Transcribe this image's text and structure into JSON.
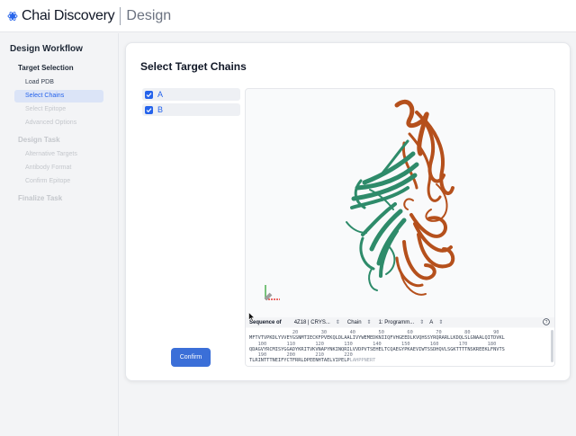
{
  "header": {
    "brand": "Chai Discovery",
    "section": "Design"
  },
  "sidebar": {
    "title": "Design Workflow",
    "groups": [
      {
        "label": "Target Selection",
        "items": [
          "Load PDB",
          "Select Chains",
          "Select Epitope",
          "Advanced Options"
        ]
      },
      {
        "label": "Design Task",
        "items": [
          "Alternative Targets",
          "Antibody Format",
          "Confirm Epitope"
        ]
      },
      {
        "label": "Finalize Task"
      }
    ]
  },
  "main": {
    "title": "Select Target Chains",
    "chains": [
      {
        "label": "A",
        "checked": true
      },
      {
        "label": "B",
        "checked": true
      }
    ],
    "confirm_label": "Confirm"
  },
  "viewer": {
    "seq_label": "Sequence of",
    "entry": "4Z18 | CRYS...",
    "mode": "Chain",
    "molecule": "1: Programm...",
    "chain": "A",
    "ruler1": "               20        30        40        50        60        70        80        90",
    "seq1": "MFTVTVPKDLYVVEYGSNMTIECKFPVEKQLDLAALIVYWEMEDKNIIQFVHGEEDLKVQHSSYRQRARLLKDQLSLGNAALQITDVKL",
    "ruler2": "   100       110       120       130       140       150       160       170       180",
    "seq2": "QDAGVYRCMISYGGADYKRITVKVNAPYNKINQRILVVDPVTSEHELTCQAEGYPKAEVIWTSSDHQVLSGKTTTTNSKREEKLFNVTS",
    "ruler3": "   190       200       210       220",
    "seq3": "TLRINTTTNEIFYCTFRRLDPEENHTAELVIPELP",
    "seq3_dim": "LAHPPNERT",
    "colors": {
      "chain_a": "#2e8b6a",
      "chain_b": "#b5501c",
      "accent": "#2563eb"
    }
  }
}
